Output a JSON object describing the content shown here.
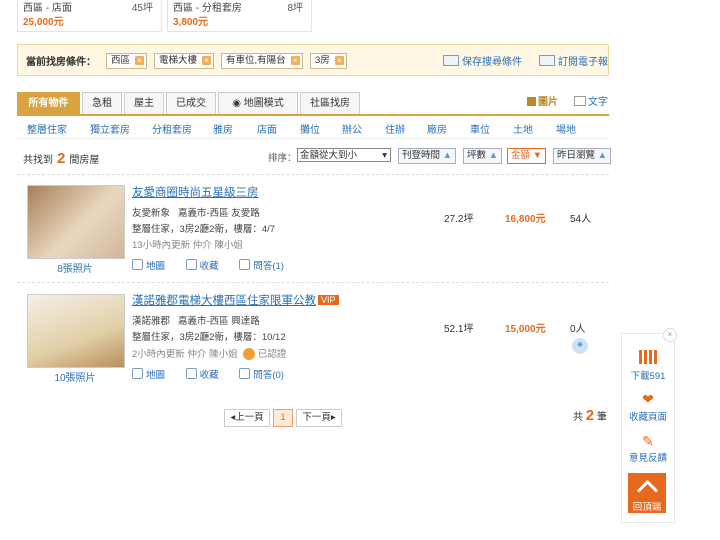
{
  "top_cards": [
    {
      "title": "西區 - 店面",
      "size": "45坪",
      "price": "25,000元"
    },
    {
      "title": "西區 - 分租套房",
      "size": "8坪",
      "price": "3,800元"
    }
  ],
  "filter": {
    "label": "當前找房條件：",
    "tags": [
      "西區",
      "電梯大樓",
      "有車位,有陽台",
      "3房"
    ],
    "save_search": "保存搜尋條件",
    "subscribe": "訂閱電子報"
  },
  "tabs": [
    "所有物件",
    "急租",
    "屋主",
    "已成交",
    "地圖模式",
    "社區找房"
  ],
  "view": {
    "image": "圖片",
    "text": "文字"
  },
  "categories": [
    "整層住家",
    "獨立套房",
    "分租套房",
    "雅房",
    "店面",
    "攤位",
    "辦公",
    "住辦",
    "廠房",
    "車位",
    "土地",
    "場地"
  ],
  "results": {
    "prefix": "共找到",
    "count": "2",
    "suffix": "間房屋"
  },
  "sort": {
    "label": "排序：",
    "selected": "金額從大到小",
    "buttons": [
      "刊登時間",
      "坪數",
      "金額",
      "昨日瀏覽"
    ]
  },
  "listings": [
    {
      "title": "友愛商圈時尚五星級三房",
      "vip": "",
      "community": "友愛新象",
      "address": "嘉義市-西區 友愛路",
      "info": "整層住家，3房2廳2衛，樓層：4/7",
      "meta": "13小時內更新  仲介 陳小姐",
      "verified": "",
      "photos": "8張照片",
      "area": "27.2坪",
      "price": "16,800元",
      "views": "54人",
      "actions": [
        "地圖",
        "收藏",
        "問答(1)"
      ]
    },
    {
      "title": "漢諾雅郡電梯大樓西區住家限軍公教",
      "vip": "VIP",
      "community": "漢諾雅郡",
      "address": "嘉義市-西區 興達路",
      "info": "整層住家，3房2廳2衛，樓層：10/12",
      "meta": "2小時內更新  仲介 陳小姐",
      "verified": "已認證",
      "photos": "10張照片",
      "area": "52.1坪",
      "price": "15,000元",
      "views": "0人",
      "actions": [
        "地圖",
        "收藏",
        "問答(0)"
      ]
    }
  ],
  "pager": {
    "prev": "上一頁",
    "page": "1",
    "next": "下一頁",
    "total_prefix": "共",
    "total": "2",
    "total_suffix": "筆"
  },
  "sidebar": {
    "download": "下載591",
    "favorite": "收藏頁面",
    "feedback": "意見反饋",
    "top": "回頂端",
    "close": "×"
  },
  "colors": {
    "accent": "#e7691d",
    "link": "#2a6fb7",
    "gold": "#d8a340"
  }
}
